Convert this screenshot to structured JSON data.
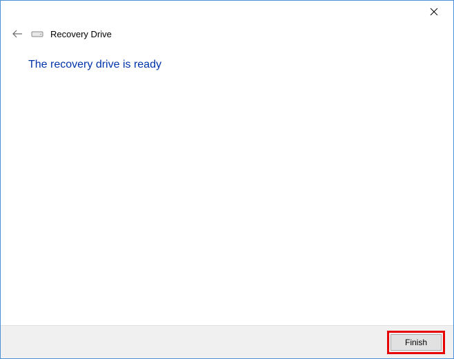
{
  "header": {
    "wizard_title": "Recovery Drive"
  },
  "content": {
    "heading": "The recovery drive is ready"
  },
  "footer": {
    "finish_label": "Finish"
  }
}
